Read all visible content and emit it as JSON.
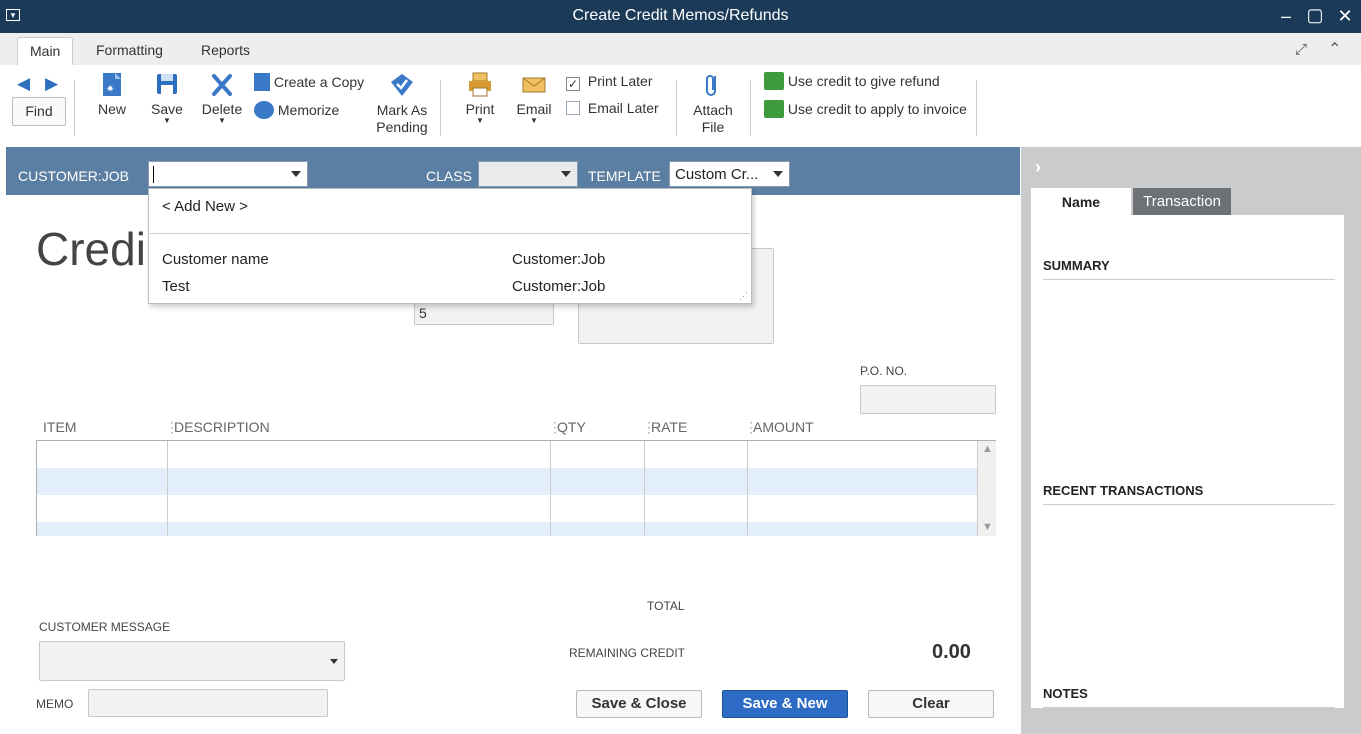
{
  "window": {
    "title": "Create Credit Memos/Refunds"
  },
  "menu": {
    "tabs": [
      "Main",
      "Formatting",
      "Reports"
    ]
  },
  "toolbar": {
    "find": "Find",
    "new": "New",
    "save": "Save",
    "delete": "Delete",
    "create_copy": "Create a Copy",
    "memorize": "Memorize",
    "mark_as_pending_1": "Mark As",
    "mark_as_pending_2": "Pending",
    "print": "Print",
    "email": "Email",
    "print_later": "Print Later",
    "email_later": "Email Later",
    "attach_1": "Attach",
    "attach_2": "File",
    "use_credit_refund": "Use credit to give refund",
    "use_credit_invoice": "Use credit to apply to invoice",
    "print_later_checked": true,
    "email_later_checked": false
  },
  "header": {
    "customer_job_label": "CUSTOMER:JOB",
    "customer_job_value": "",
    "class_label": "CLASS",
    "class_value": "",
    "template_label": "TEMPLATE",
    "template_value": "Custom Cr..."
  },
  "dropdown": {
    "add_new": "< Add New >",
    "items": [
      {
        "name": "Customer name",
        "type": "Customer:Job"
      },
      {
        "name": "Test",
        "type": "Customer:Job"
      }
    ]
  },
  "form": {
    "title": "Credi",
    "credit_no_value": "5",
    "po_label": "P.O. NO.",
    "columns": [
      "ITEM",
      "DESCRIPTION",
      "QTY",
      "RATE",
      "AMOUNT"
    ],
    "total_label": "TOTAL",
    "customer_message_label": "CUSTOMER MESSAGE",
    "remaining_credit_label": "REMAINING CREDIT",
    "remaining_credit_value": "0.00",
    "memo_label": "MEMO"
  },
  "buttons": {
    "save_close": "Save & Close",
    "save_new": "Save & New",
    "clear": "Clear"
  },
  "sidepanel": {
    "tabs": [
      "Name",
      "Transaction"
    ],
    "summary": "SUMMARY",
    "recent": "RECENT TRANSACTIONS",
    "notes": "NOTES"
  },
  "colors": {
    "titlebar": "#1b3a57",
    "header_band": "#5b7fa3",
    "primary_button": "#2d6bc4"
  }
}
